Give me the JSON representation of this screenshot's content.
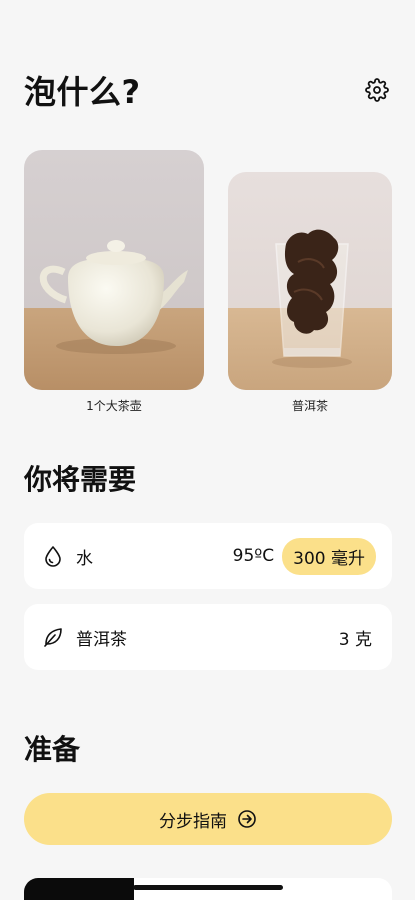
{
  "header": {
    "title": "泡什么?",
    "settings_icon": "gear-icon"
  },
  "vessels": [
    {
      "caption": "1个大茶壶",
      "image": "white-teapot"
    },
    {
      "caption": "普洱茶",
      "image": "pu-erh-tea-in-glass"
    }
  ],
  "needs": {
    "title": "你将需要",
    "water": {
      "icon": "water-drop-icon",
      "label": "水",
      "temperature": "95ºC",
      "volume": "300 毫升"
    },
    "tea": {
      "icon": "leaf-icon",
      "label": "普洱茶",
      "amount": "3 克"
    }
  },
  "prepare": {
    "title": "准备",
    "guide_button": "分步指南",
    "guide_icon": "arrow-right-circle-icon"
  },
  "colors": {
    "accent": "#fbe08a",
    "background": "#f6f6f6",
    "card": "#ffffff"
  }
}
